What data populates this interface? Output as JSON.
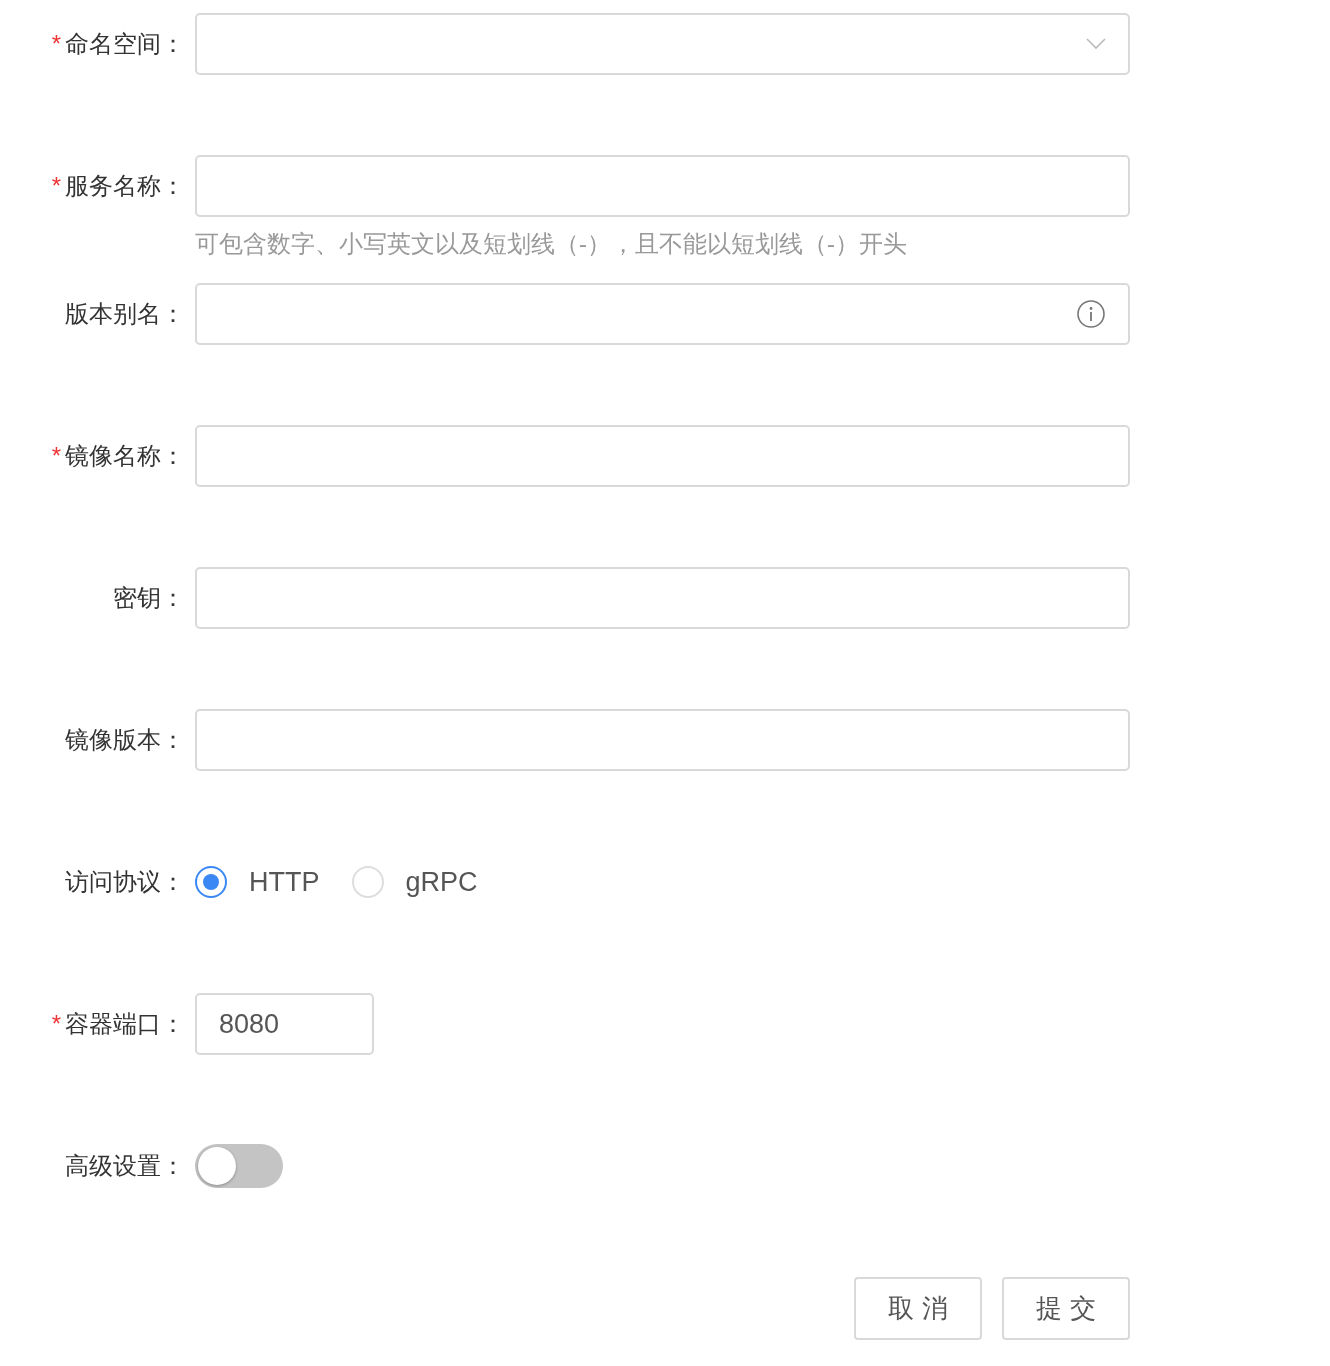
{
  "form": {
    "fields": [
      {
        "kind": "select",
        "required_mark": "*",
        "label": "命名空间："
      },
      {
        "kind": "input",
        "required_mark": "*",
        "label": "服务名称：",
        "hint": "可包含数字、小写英文以及短划线（-），且不能以短划线（-）开头"
      },
      {
        "kind": "input_info",
        "label": "版本别名："
      },
      {
        "kind": "input",
        "required_mark": "*",
        "label": "镜像名称："
      },
      {
        "kind": "input",
        "label": "密钥："
      },
      {
        "kind": "input",
        "label": "镜像版本："
      },
      {
        "kind": "radio",
        "label": "访问协议：",
        "options": [
          {
            "label": "HTTP",
            "selected": true
          },
          {
            "label": "gRPC",
            "selected": false
          }
        ]
      },
      {
        "kind": "number",
        "required_mark": "*",
        "label": "容器端口：",
        "value": "8080"
      },
      {
        "kind": "switch",
        "label": "高级设置：",
        "on": false
      }
    ],
    "buttons": [
      "取 消",
      "提 交"
    ]
  }
}
